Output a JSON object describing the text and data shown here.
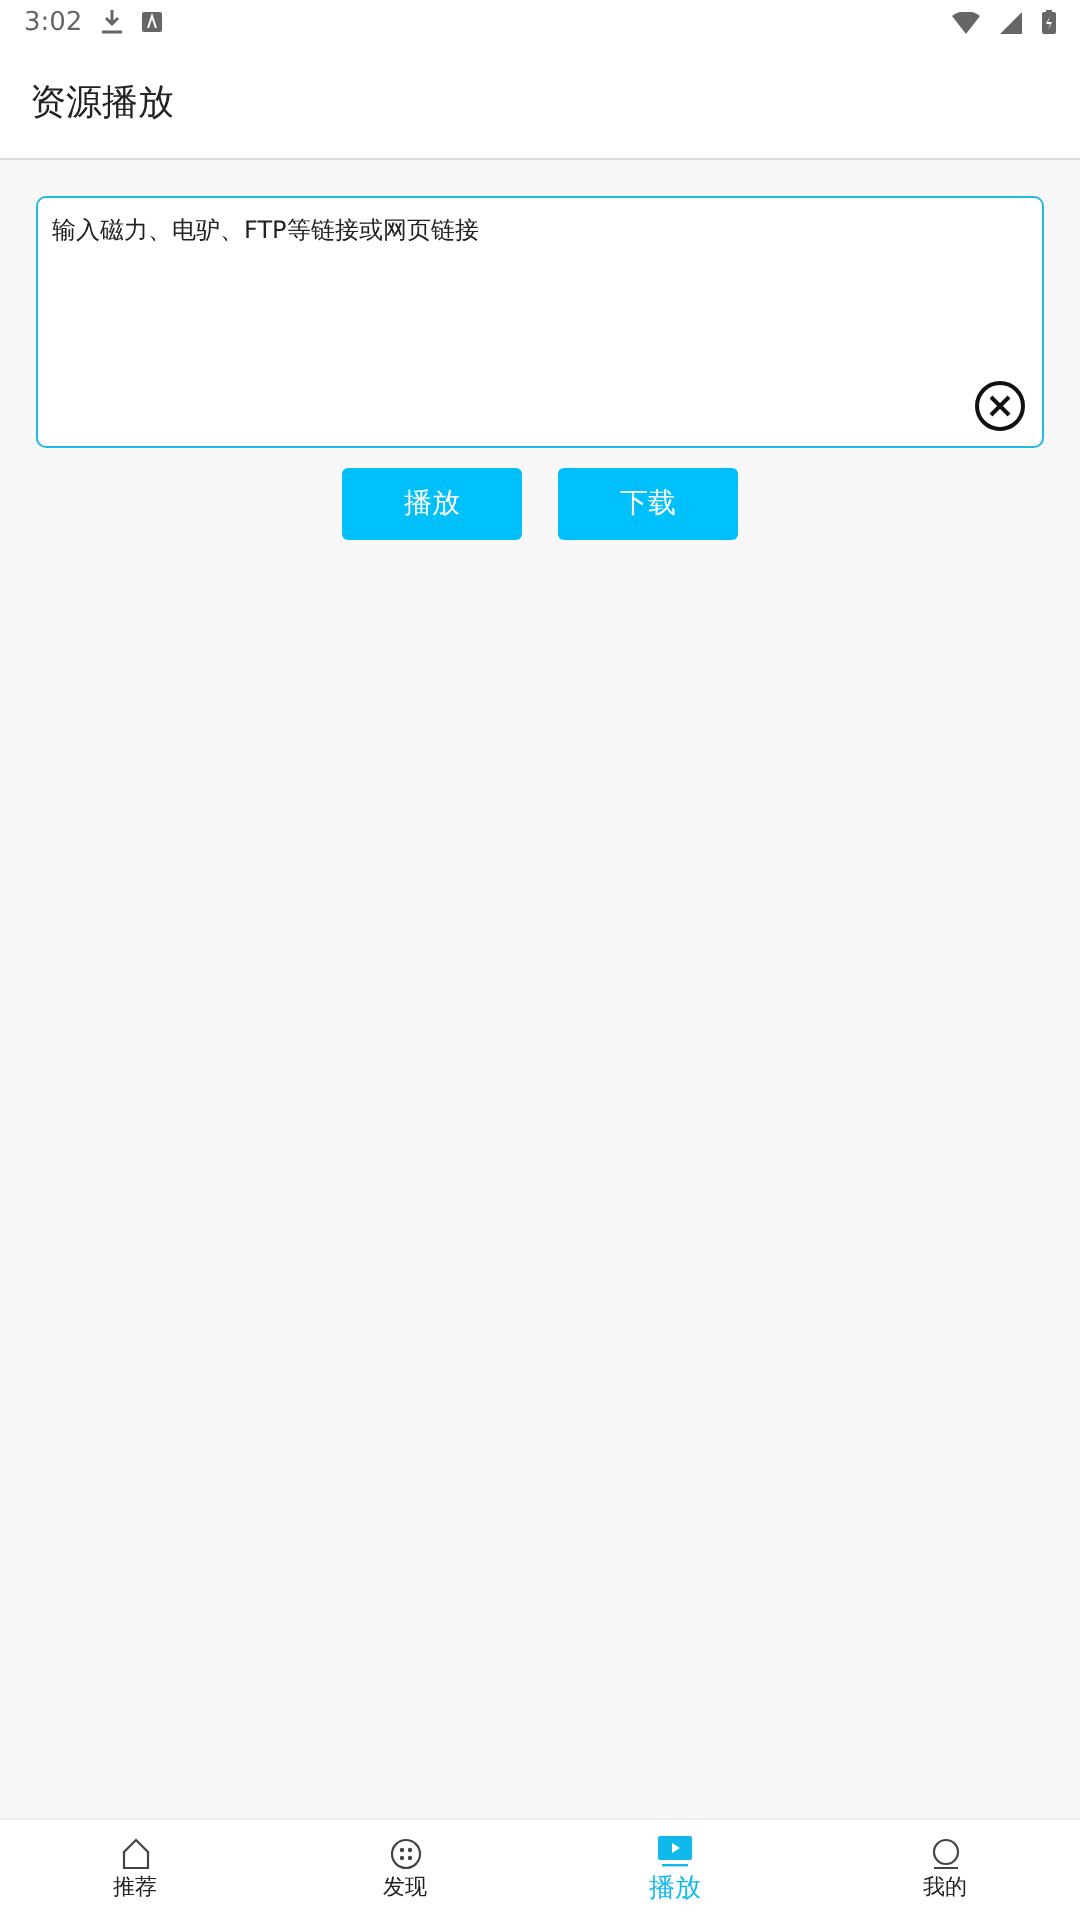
{
  "status_bar": {
    "time": "3:02"
  },
  "header": {
    "title": "资源播放"
  },
  "link_input": {
    "placeholder": "输入磁力、电驴、FTP等链接或网页链接"
  },
  "buttons": [
    {
      "label": "播放"
    },
    {
      "label": "下载"
    }
  ],
  "tabs": [
    {
      "label": "推荐",
      "kind": "home",
      "selected": false
    },
    {
      "label": "发现",
      "kind": "discover",
      "selected": false
    },
    {
      "label": "播放",
      "kind": "play",
      "selected": true
    },
    {
      "label": "我的",
      "kind": "profile",
      "selected": false
    }
  ]
}
